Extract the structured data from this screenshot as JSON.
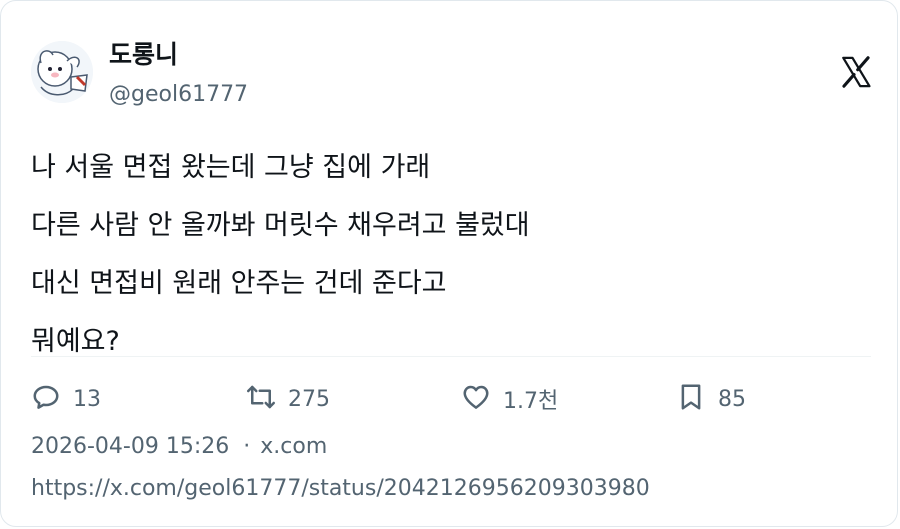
{
  "author": {
    "display_name": "도롱니",
    "handle": "@geol61777"
  },
  "tweet": {
    "lines": [
      "나 서울 면접 왔는데 그냥 집에 가래",
      "다른 사람 안 올까봐 머릿수 채우려고 불렀대",
      "대신 면접비 원래 안주는 건데 준다고",
      "뭐예요?"
    ]
  },
  "stats": {
    "replies": "13",
    "retweets": "275",
    "likes": "1.7천",
    "bookmarks": "85"
  },
  "meta": {
    "timestamp": "2026-04-09 15:26",
    "separator": "·",
    "source": "x.com"
  },
  "url": "https://x.com/geol61777/status/2042126956209303980",
  "icons": {
    "brand": "x-logo-icon",
    "reply": "reply-icon",
    "retweet": "retweet-icon",
    "like": "heart-icon",
    "bookmark": "bookmark-icon"
  },
  "colors": {
    "text": "#0f1419",
    "secondary": "#536471",
    "border": "#e1e8ed"
  }
}
